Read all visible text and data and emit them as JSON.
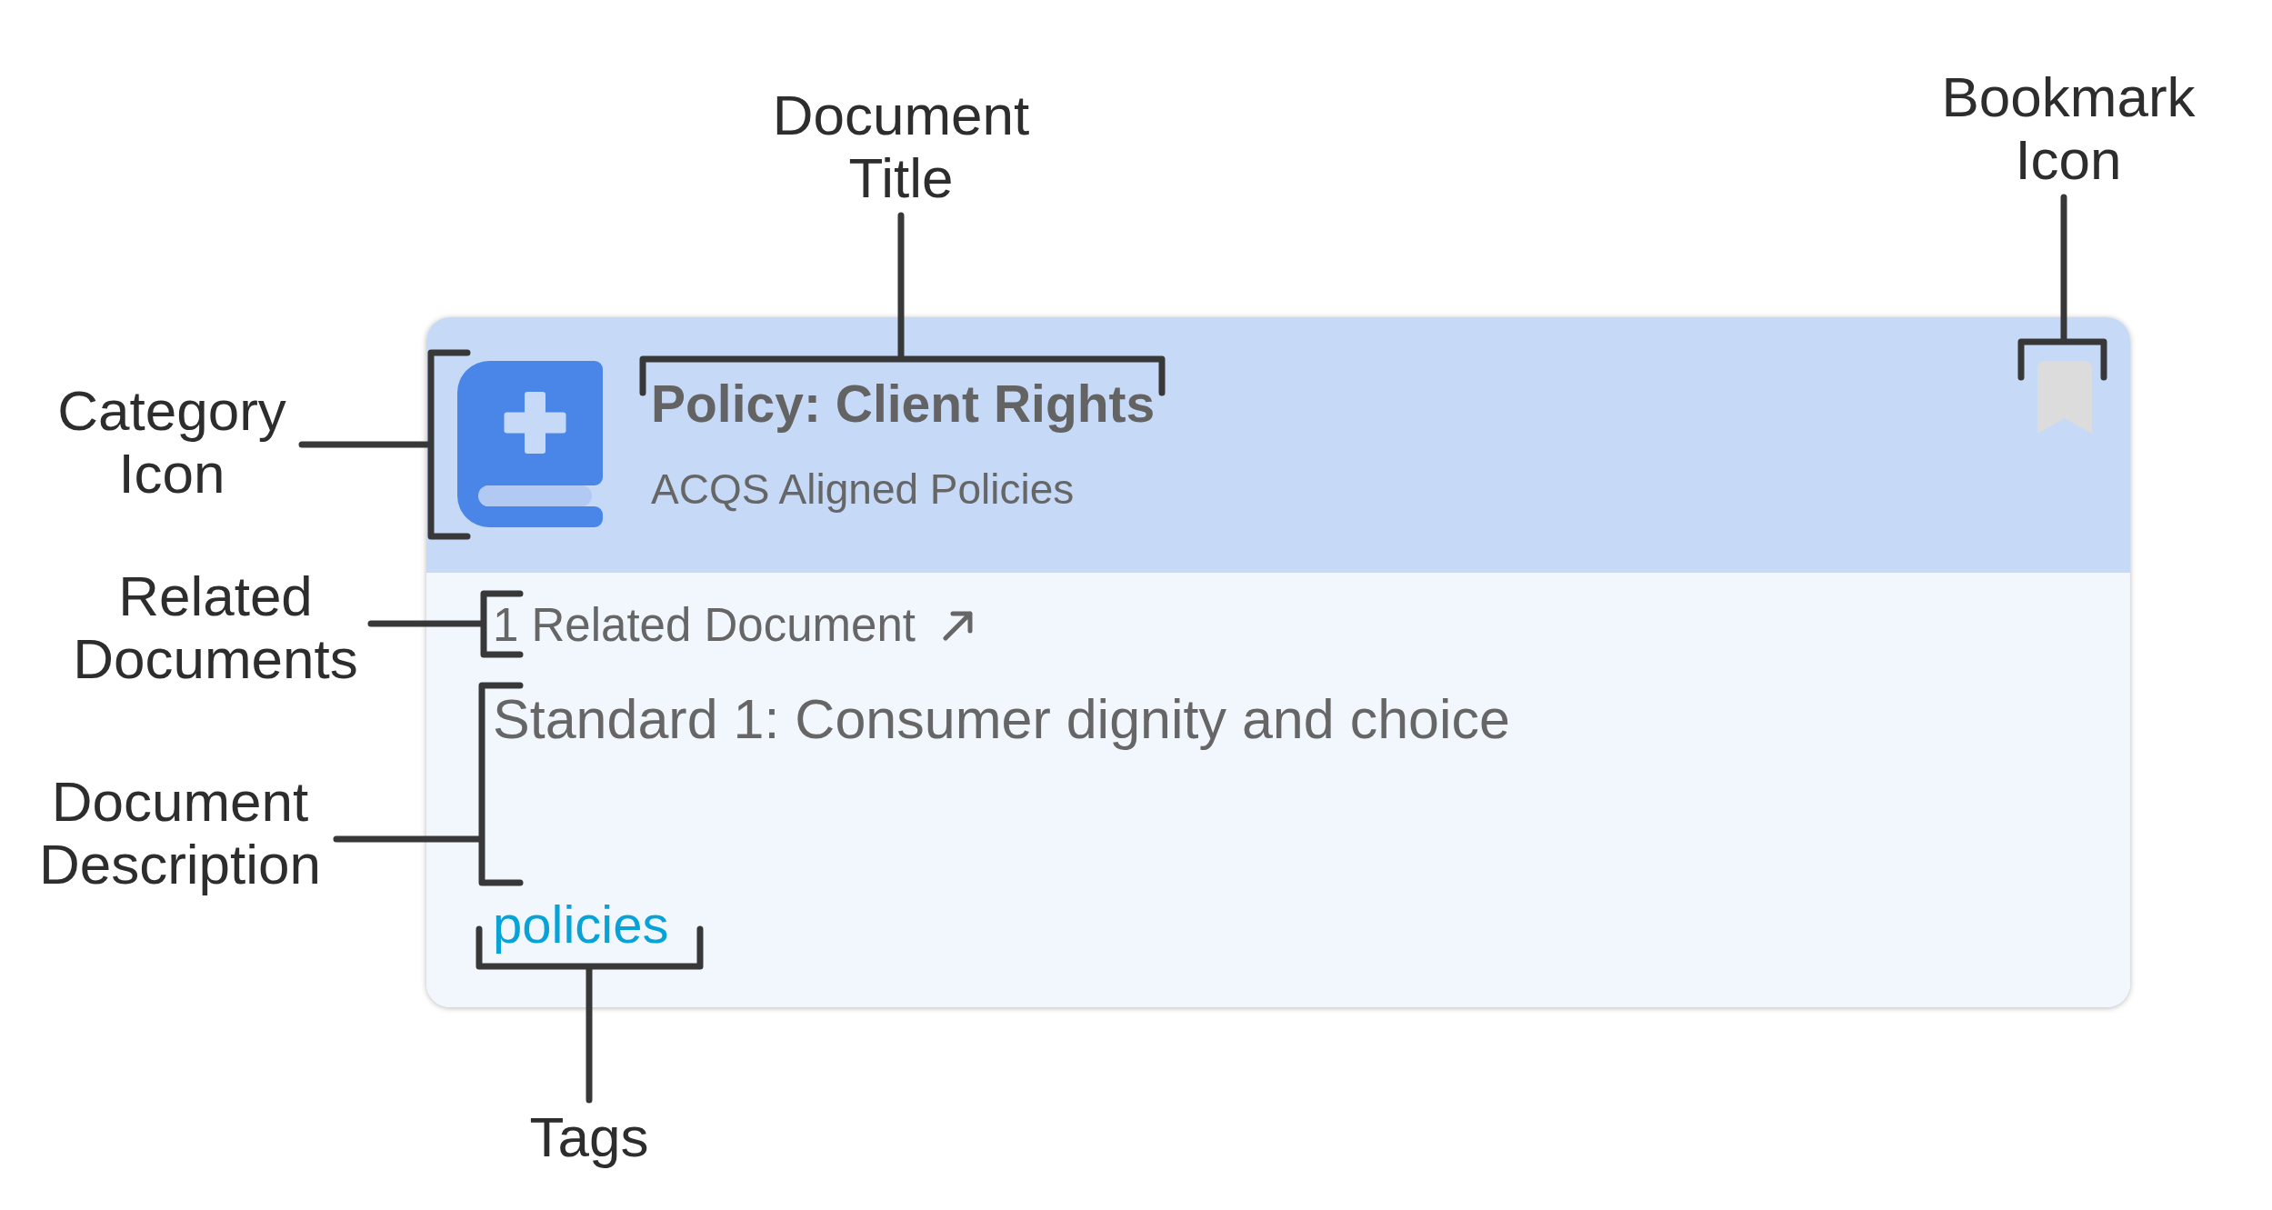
{
  "annotations": [
    {
      "label": "Document Title"
    },
    {
      "label": "Bookmark Icon"
    },
    {
      "label": "Category Icon"
    },
    {
      "label": "Related Documents"
    },
    {
      "label": "Document Description"
    },
    {
      "label": "Tags"
    }
  ],
  "card": {
    "title": "Policy: Client Rights",
    "category": "ACQS Aligned Policies",
    "bookmarked": false,
    "related_documents": "1 Related Document",
    "description": "Standard 1: Consumer dignity and choice",
    "tags": [
      "policies"
    ]
  }
}
